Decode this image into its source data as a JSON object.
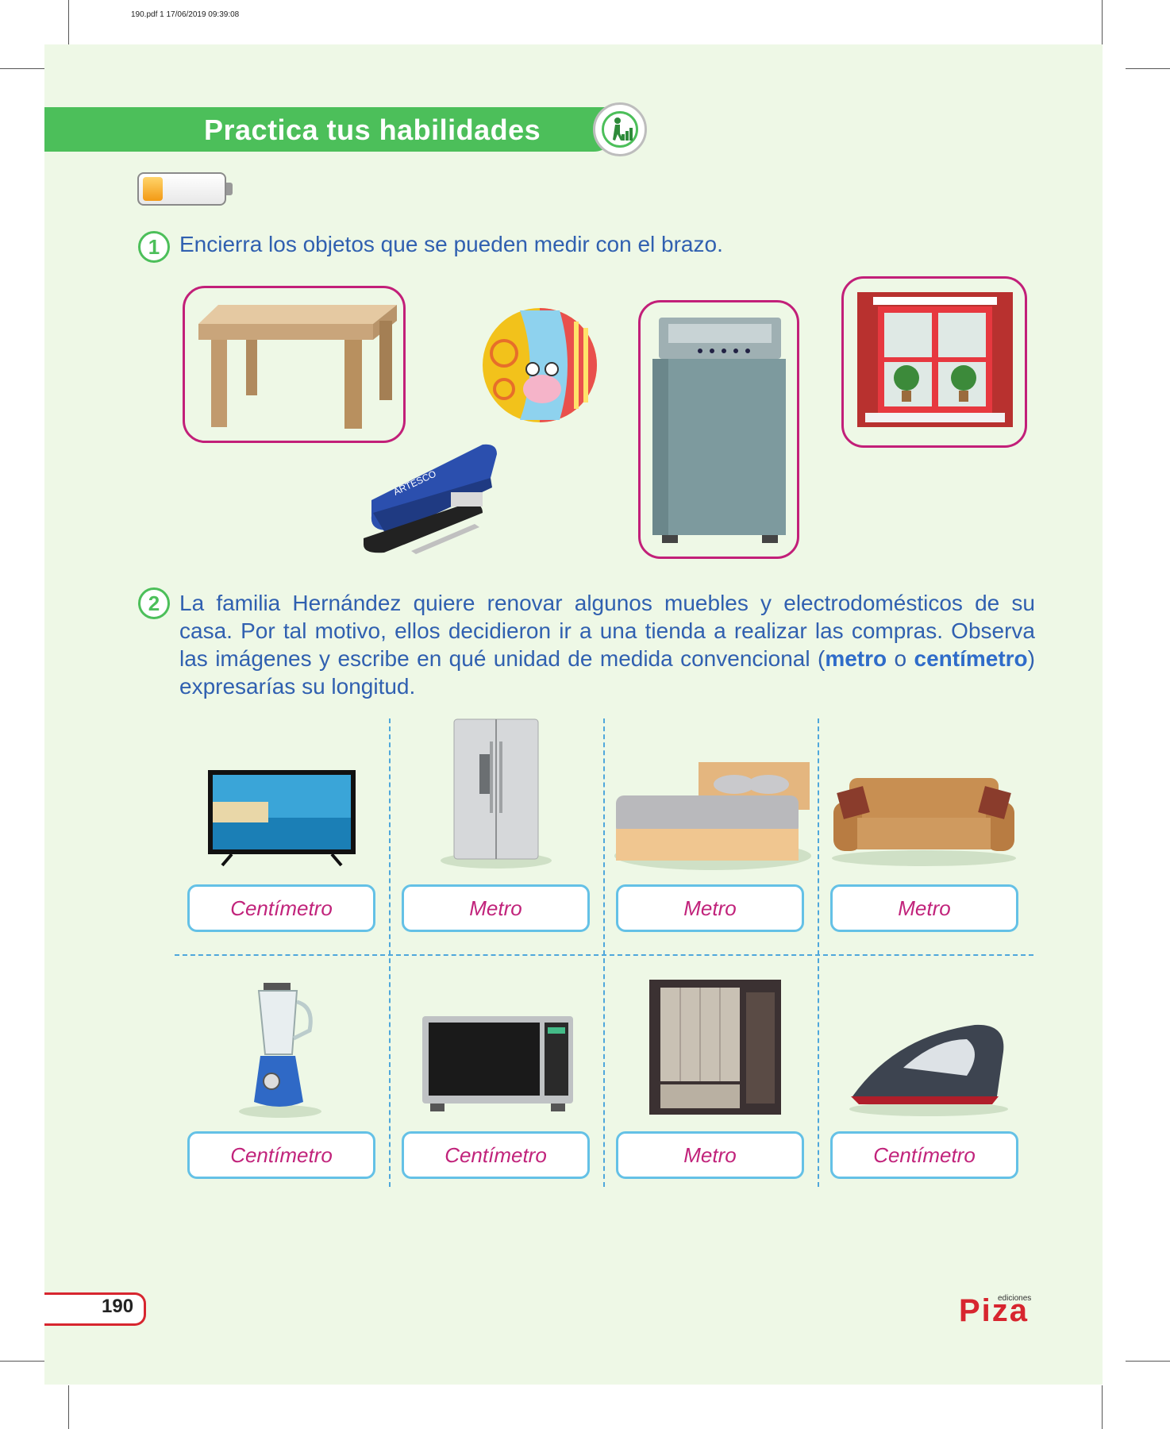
{
  "print_meta": "190.pdf  1  17/06/2019  09:39:08",
  "header": {
    "title": "Practica tus habilidades"
  },
  "progress": {
    "level": 0.25
  },
  "exercise1": {
    "number": "1",
    "instruction": "Encierra los objetos que se pueden medir con el brazo."
  },
  "exercise2": {
    "number": "2",
    "text_before": "La familia Hernández quiere renovar algunos muebles y electrodomésticos de su casa. Por tal motivo, ellos decidieron ir a una tienda a realizar las compras. Observa las imágenes y escribe en qué unidad de medida convencional (",
    "bold1": "metro",
    "text_mid": " o ",
    "bold2": "centímetro",
    "text_after": ") expresarías su longitud.",
    "answers_row1": [
      "Centímetro",
      "Metro",
      "Metro",
      "Metro"
    ],
    "answers_row2": [
      "Centímetro",
      "Centímetro",
      "Metro",
      "Centímetro"
    ]
  },
  "footer": {
    "page_number": "190",
    "publisher": "Piza",
    "publisher_small": "ediciones"
  },
  "colors": {
    "banner": "#4cbf5a",
    "frame": "#c21f79",
    "answer_text": "#c1237b",
    "answer_border": "#64c1e6",
    "text_blue": "#3060b0"
  }
}
